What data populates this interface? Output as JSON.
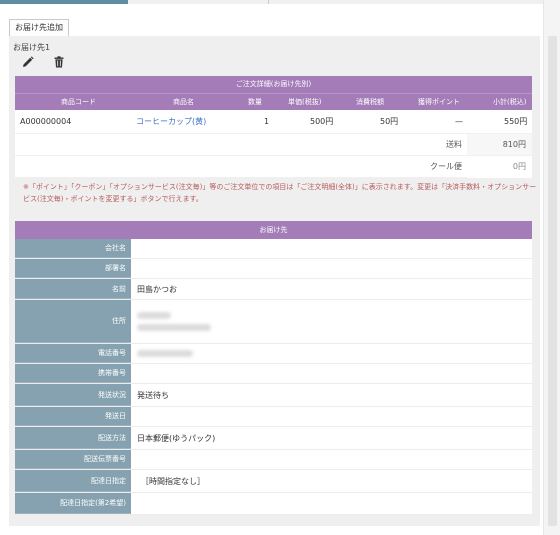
{
  "toolbar": {
    "add_destination_label": "お届け先追加"
  },
  "destination": {
    "label": "お届け先1",
    "icons": {
      "edit": "pencil-icon",
      "delete": "trash-icon"
    }
  },
  "order_details": {
    "caption": "ご注文詳細(お届け先別)",
    "columns": [
      "商品コード",
      "商品名",
      "数量",
      "単価(税抜)",
      "消費税額",
      "獲得ポイント",
      "小計(税込)"
    ],
    "items": [
      {
        "code": "A000000004",
        "name": "コーヒーカップ(黄)",
        "qty": "1",
        "unit_price": "500円",
        "tax": "50円",
        "points": "—",
        "subtotal": "550円"
      }
    ],
    "shipping_label": "送料",
    "shipping_value": "810円",
    "cool_label": "クール便",
    "cool_value": "0円"
  },
  "note": "※「ポイント」「クーポン」「オプションサービス(注文毎)」等のご注文単位での項目は「ご注文明細(全体)」に表示されます。変更は「決済手数料・オプションサービス(注文毎)・ポイントを変更する」ボタンで行えます。",
  "delivery": {
    "caption": "お届け先",
    "rows": [
      {
        "label": "会社名",
        "value": ""
      },
      {
        "label": "部署名",
        "value": ""
      },
      {
        "label": "名前",
        "value": "田島かつお"
      },
      {
        "label": "住所",
        "value": ""
      },
      {
        "label": "電話番号",
        "value": ""
      },
      {
        "label": "携帯番号",
        "value": ""
      },
      {
        "label": "発送状況",
        "value": "発送待ち"
      },
      {
        "label": "発送日",
        "value": ""
      },
      {
        "label": "配送方法",
        "value": "日本郵便(ゆうパック)"
      },
      {
        "label": "配送伝票番号",
        "value": ""
      },
      {
        "label": "配達日指定",
        "value": "［時間指定なし］"
      },
      {
        "label": "配達日指定(第2希望)",
        "value": ""
      }
    ]
  },
  "colors": {
    "header_purple": "#a47cb7",
    "label_blue": "#86a2b0",
    "link": "#3b6fc4",
    "note_red": "#b55a5a"
  }
}
